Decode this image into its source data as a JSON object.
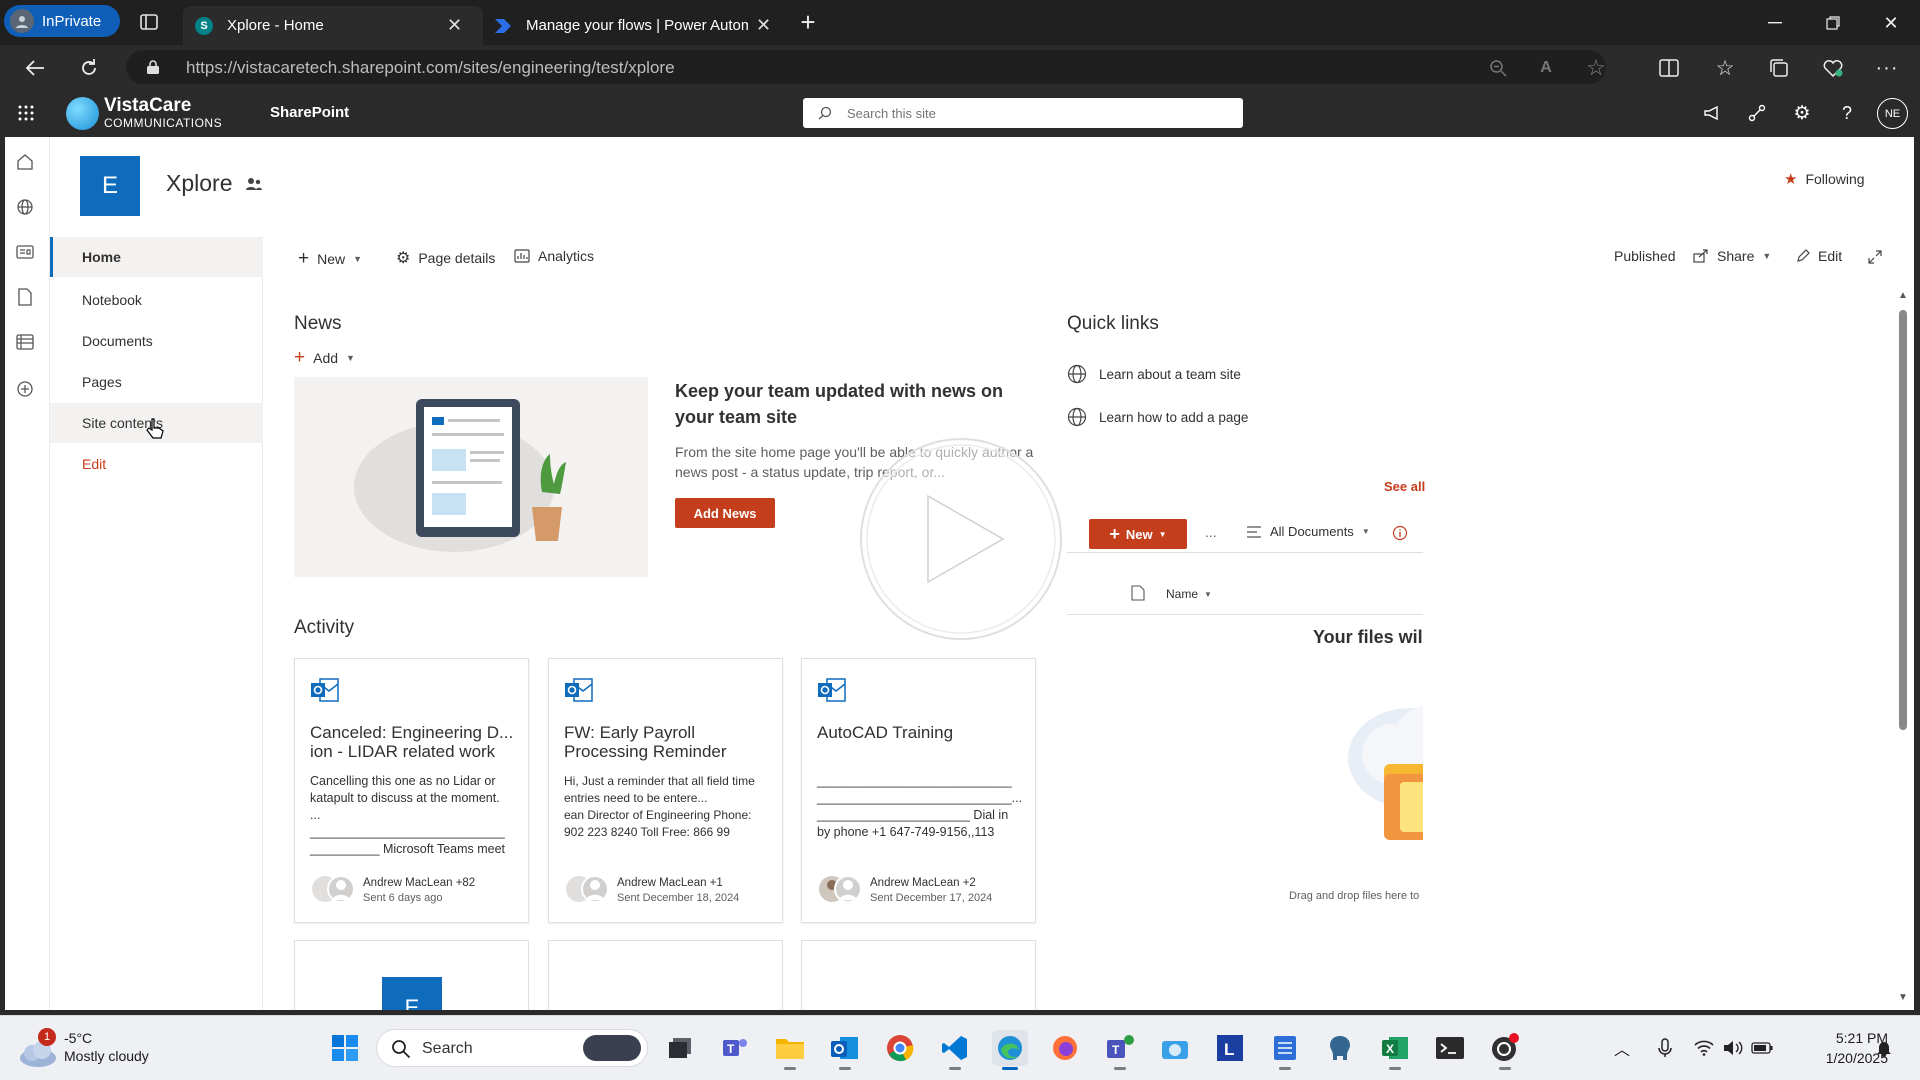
{
  "browser": {
    "inprivate_label": "InPrivate",
    "tabs": [
      {
        "title": "Xplore - Home",
        "active": true
      },
      {
        "title": "Manage your flows | Power Autom",
        "active": false
      }
    ],
    "url": "https://vistacaretech.sharepoint.com/sites/engineering/test/xplore"
  },
  "suite": {
    "brand_line1": "VistaCare",
    "brand_line2": "COMMUNICATIONS",
    "app_name": "SharePoint",
    "search_placeholder": "Search this site",
    "avatar_initials": "NE"
  },
  "site": {
    "logo_letter": "E",
    "title": "Xplore",
    "following_label": "Following"
  },
  "left_nav": {
    "items": [
      "Home",
      "Notebook",
      "Documents",
      "Pages",
      "Site contents"
    ],
    "edit_label": "Edit",
    "selected": "Home"
  },
  "commandbar": {
    "new_label": "New",
    "page_details_label": "Page details",
    "analytics_label": "Analytics",
    "status_label": "Published",
    "share_label": "Share",
    "edit_label": "Edit"
  },
  "news": {
    "heading": "News",
    "add_label": "Add",
    "promo_title": "Keep your team updated with news on your team site",
    "promo_body": "From the site home page you'll be able to quickly author a news post - a status update, trip report, or...",
    "add_news_button": "Add News"
  },
  "quick_links": {
    "heading": "Quick links",
    "items": [
      "Learn about a team site",
      "Learn how to add a page"
    ]
  },
  "documents": {
    "see_all_label": "See all",
    "new_button": "New",
    "more_label": "...",
    "view_label": "All Documents",
    "column_name": "Name",
    "empty_title": "Your files wil",
    "drop_hint": "Drag and drop files here to"
  },
  "activity": {
    "heading": "Activity",
    "cards": [
      {
        "title": "Canceled: Engineering D... ion - LIDAR related work",
        "body": "Cancelling this one as no Lidar or katapult to discuss at the moment.\n...\n____________________________\n__________ Microsoft Teams meet",
        "author": "Andrew MacLean +82",
        "sent": "Sent 6 days ago"
      },
      {
        "title": "FW: Early Payroll Processing Reminder",
        "body": "Hi, Just a reminder that all field time entries need to be entere...\nean Director of Engineering Phone:\n902 223 8240 Toll Free: 866 99",
        "author": "Andrew MacLean +1",
        "sent": "Sent December 18, 2024"
      },
      {
        "title": "AutoCAD Training",
        "body": "\n____________________________\n____________________________...\n______________________ Dial in\nby phone +1 647-749-9156,,113",
        "author": "Andrew MacLean +2",
        "sent": "Sent December 17, 2024"
      }
    ],
    "next_card_letter": "E"
  },
  "taskbar": {
    "weather_badge": "1",
    "weather_temp": "-5°C",
    "weather_desc": "Mostly cloudy",
    "search_label": "Search",
    "time": "5:21 PM",
    "date": "1/20/2025"
  },
  "colors": {
    "accent": "#c43e1c",
    "site_logo": "#0f6cbd",
    "chrome_dark": "#202020",
    "suite_bar": "#2a2a2a"
  }
}
